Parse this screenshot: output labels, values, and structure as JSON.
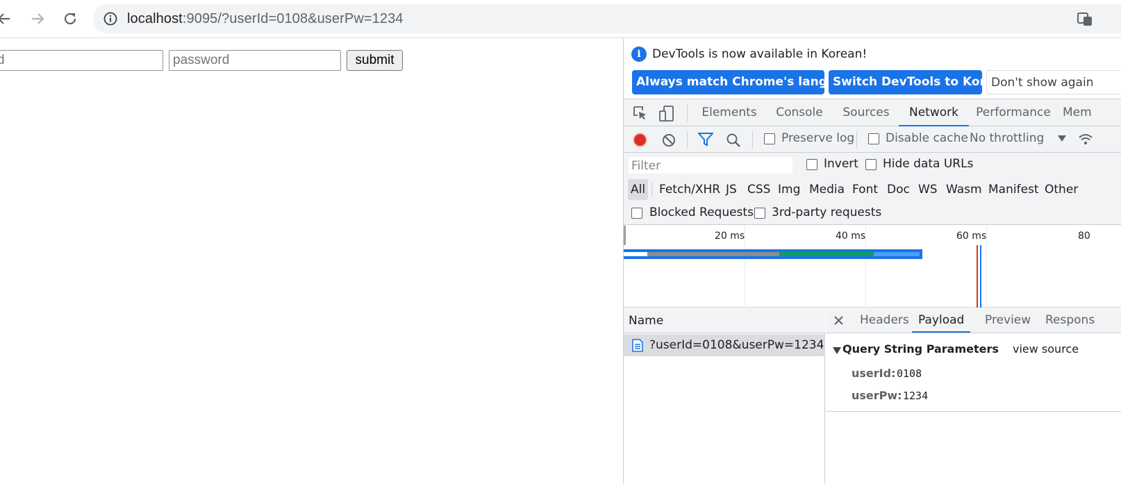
{
  "browser": {
    "url_host": "localhost",
    "url_rest": ":9095/?userId=0108&userPw=1234"
  },
  "page": {
    "id_input_text": "d",
    "password_placeholder": "password",
    "submit_label": "submit"
  },
  "devtools": {
    "infobar": {
      "message": "DevTools is now available in Korean!",
      "btn_match": "Always match Chrome's language",
      "btn_switch": "Switch DevTools to Korean",
      "btn_dismiss": "Don't show again"
    },
    "tabs": [
      "Elements",
      "Console",
      "Sources",
      "Network",
      "Performance",
      "Mem"
    ],
    "active_tab": "Network",
    "network_toolbar": {
      "preserve_log": "Preserve log",
      "disable_cache": "Disable cache",
      "throttling": "No throttling"
    },
    "filter": {
      "placeholder": "Filter",
      "invert": "Invert",
      "hide_data_urls": "Hide data URLs",
      "types": [
        "All",
        "Fetch/XHR",
        "JS",
        "CSS",
        "Img",
        "Media",
        "Font",
        "Doc",
        "WS",
        "Wasm",
        "Manifest",
        "Other"
      ],
      "active_type": "All",
      "blocked_requests": "Blocked Requests",
      "third_party": "3rd-party requests"
    },
    "overview": {
      "ticks": [
        "20 ms",
        "40 ms",
        "60 ms",
        "80"
      ]
    },
    "requests": {
      "header": "Name",
      "rows": [
        {
          "name": "?userId=0108&userPw=1234"
        }
      ]
    },
    "details": {
      "tabs": [
        "Headers",
        "Payload",
        "Preview",
        "Respons"
      ],
      "active_tab": "Payload",
      "section_title": "Query String Parameters",
      "view_source": "view source",
      "params": [
        {
          "key": "userId:",
          "value": "0108"
        },
        {
          "key": "userPw:",
          "value": "1234"
        }
      ]
    },
    "colors": {
      "accent": "#1a73e8",
      "record": "#d93025"
    }
  }
}
